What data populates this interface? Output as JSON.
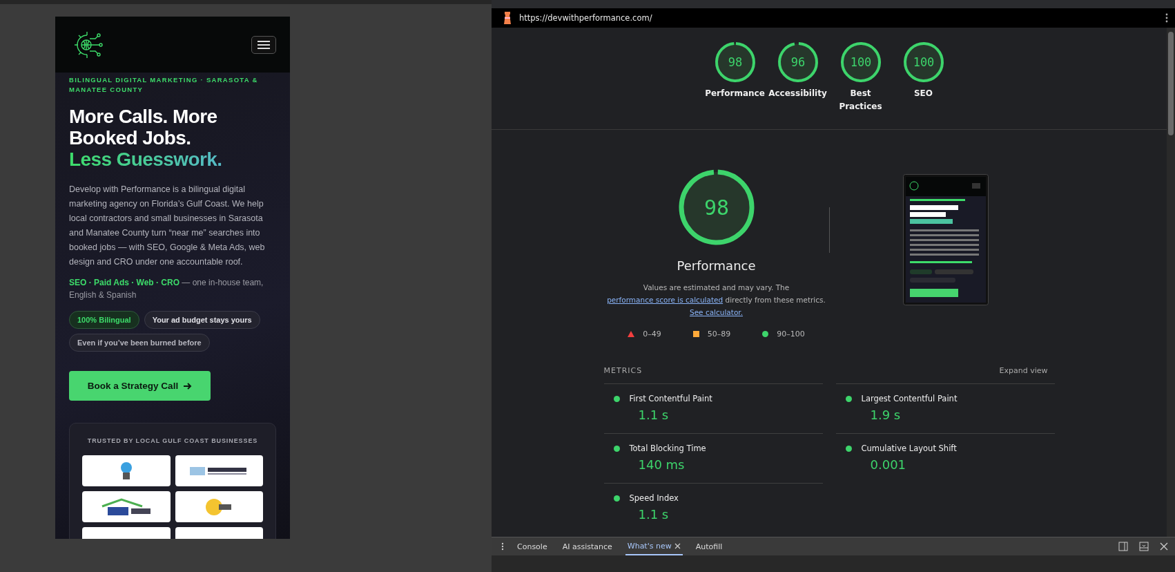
{
  "site": {
    "eyebrow": "BILINGUAL DIGITAL MARKETING · SARASOTA & MANATEE COUNTY",
    "headline": "More Calls. More Booked Jobs.",
    "headline_accent": "Less Guesswork.",
    "intro": "Develop with Performance is a bilingual digital marketing agency on Florida’s Gulf Coast. We help local contractors and small businesses in Sarasota and Manatee County turn “near me” searches into booked jobs — with SEO, Google & Meta Ads, web design and CRO under one accountable roof.",
    "services": "SEO · Paid Ads · Web · CRO",
    "services_note": "— one in-house team, English & Spanish",
    "chips": [
      {
        "label": "100% Bilingual",
        "highlighted": true
      },
      {
        "label": "Your ad budget stays yours",
        "highlighted": false
      },
      {
        "label": "Even if you’ve been burned before",
        "highlighted": false
      }
    ],
    "cta": "Book a Strategy Call",
    "trusted_title": "TRUSTED BY LOCAL GULF COAST BUSINESSES",
    "logos": [
      {
        "kind": "tree"
      },
      {
        "kind": "wordmark"
      },
      {
        "kind": "roof"
      },
      {
        "kind": "sun"
      },
      {
        "kind": "cropped"
      },
      {
        "kind": "cropped"
      }
    ]
  },
  "devtools": {
    "url": "https://devwithperformance.com/",
    "scores": [
      {
        "label": "Performance",
        "score": "98",
        "level": 0.98
      },
      {
        "label": "Accessibility",
        "score": "96",
        "level": 0.96
      },
      {
        "label": "Best Practices",
        "score": "100",
        "level": 1
      },
      {
        "label": "SEO",
        "score": "100",
        "level": 1
      }
    ],
    "summary": {
      "score": "98",
      "level": 0.98,
      "label": "Performance",
      "note_before": "Values are estimated and may vary. The",
      "link_score": "performance score is calculated",
      "note_middle": "directly from these metrics.",
      "link_calc": "See calculator."
    },
    "legend": [
      {
        "kind": "fail",
        "range": "0–49"
      },
      {
        "kind": "average",
        "range": "50–89"
      },
      {
        "kind": "pass",
        "range": "90–100"
      }
    ],
    "metrics": {
      "title": "METRICS",
      "expand": "Expand view",
      "items": [
        {
          "label": "First Contentful Paint",
          "value": "1.1 s"
        },
        {
          "label": "Largest Contentful Paint",
          "value": "1.9 s"
        },
        {
          "label": "Total Blocking Time",
          "value": "140 ms"
        },
        {
          "label": "Cumulative Layout Shift",
          "value": "0.001"
        },
        {
          "label": "Speed Index",
          "value": "1.1 s"
        }
      ]
    },
    "drawer_tabs": [
      {
        "label": "Console",
        "selected": false,
        "closable": false
      },
      {
        "label": "AI assistance",
        "selected": false,
        "closable": false
      },
      {
        "label": "What's new",
        "selected": true,
        "closable": true
      },
      {
        "label": "Autofill",
        "selected": false,
        "closable": false
      }
    ]
  }
}
